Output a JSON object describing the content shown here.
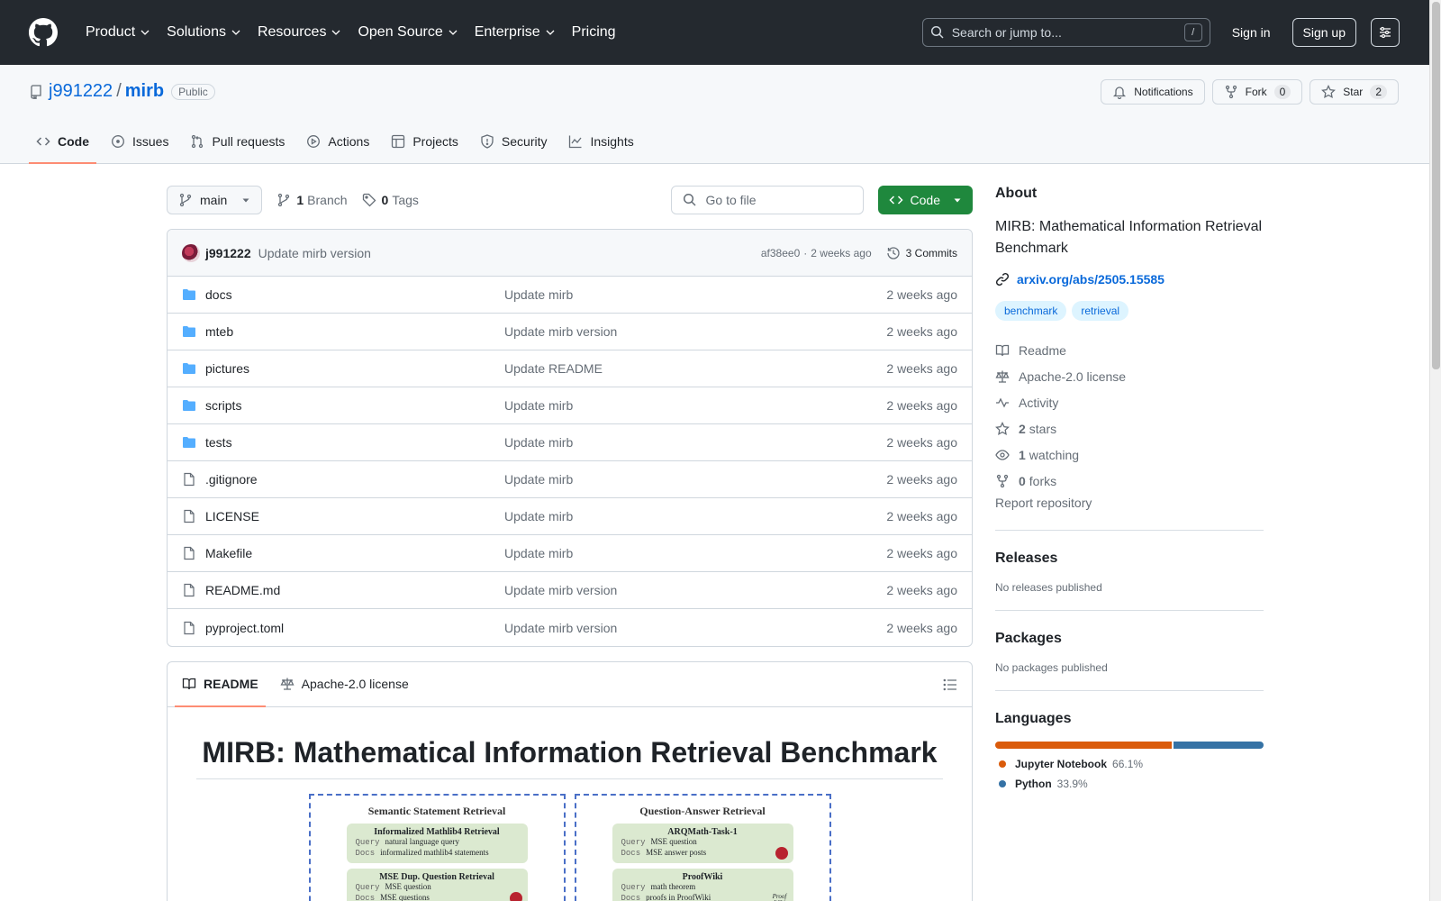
{
  "header": {
    "nav": [
      "Product",
      "Solutions",
      "Resources",
      "Open Source",
      "Enterprise",
      "Pricing"
    ],
    "search_placeholder": "Search or jump to...",
    "search_shortcut": "/",
    "signin": "Sign in",
    "signup": "Sign up"
  },
  "repo": {
    "owner": "j991222",
    "sep": "/",
    "name": "mirb",
    "visibility": "Public",
    "notifications": "Notifications",
    "fork_label": "Fork",
    "fork_count": "0",
    "star_label": "Star",
    "star_count": "2",
    "tabs": [
      "Code",
      "Issues",
      "Pull requests",
      "Actions",
      "Projects",
      "Security",
      "Insights"
    ]
  },
  "toolbar": {
    "branch": "main",
    "branch_count": "1",
    "branch_label": "Branch",
    "tag_count": "0",
    "tag_label": "Tags",
    "goto_placeholder": "Go to file",
    "code_button": "Code"
  },
  "commit": {
    "user": "j991222",
    "message": "Update mirb version",
    "hash": "af38ee0",
    "dot": "·",
    "time": "2 weeks ago",
    "commits": "3 Commits"
  },
  "files": [
    {
      "name": "docs",
      "type": "dir",
      "message": "Update mirb",
      "time": "2 weeks ago"
    },
    {
      "name": "mteb",
      "type": "dir",
      "message": "Update mirb version",
      "time": "2 weeks ago"
    },
    {
      "name": "pictures",
      "type": "dir",
      "message": "Update README",
      "time": "2 weeks ago"
    },
    {
      "name": "scripts",
      "type": "dir",
      "message": "Update mirb",
      "time": "2 weeks ago"
    },
    {
      "name": "tests",
      "type": "dir",
      "message": "Update mirb",
      "time": "2 weeks ago"
    },
    {
      "name": ".gitignore",
      "type": "file",
      "message": "Update mirb",
      "time": "2 weeks ago"
    },
    {
      "name": "LICENSE",
      "type": "file",
      "message": "Update mirb",
      "time": "2 weeks ago"
    },
    {
      "name": "Makefile",
      "type": "file",
      "message": "Update mirb",
      "time": "2 weeks ago"
    },
    {
      "name": "README.md",
      "type": "file",
      "message": "Update mirb version",
      "time": "2 weeks ago"
    },
    {
      "name": "pyproject.toml",
      "type": "file",
      "message": "Update mirb version",
      "time": "2 weeks ago"
    }
  ],
  "readme": {
    "tab_readme": "README",
    "tab_license": "Apache-2.0 license",
    "title": "MIRB: Mathematical Information Retrieval Benchmark",
    "figure": {
      "left_title": "Semantic Statement Retrieval",
      "left_cards": [
        {
          "title": "Informalized Mathlib4 Retrieval",
          "query": "natural language query",
          "docs": "informalized mathlib4 statements"
        },
        {
          "title": "MSE Dup. Question Retrieval",
          "query": "MSE question",
          "docs": "MSE questions"
        }
      ],
      "right_title": "Question-Answer Retrieval",
      "right_cards": [
        {
          "title": "ARQMath-Task-1",
          "query": "MSE question",
          "docs": "MSE answer posts"
        },
        {
          "title": "ProofWiki",
          "query": "math theorem",
          "docs": "proofs in ProofWiki"
        }
      ],
      "query_label": "Query",
      "docs_label": "Docs",
      "proofwiki_mark": "Proof Wiki"
    }
  },
  "about": {
    "heading": "About",
    "description": "MIRB: Mathematical Information Retrieval Benchmark",
    "link": "arxiv.org/abs/2505.15585",
    "topics": [
      "benchmark",
      "retrieval"
    ],
    "readme": "Readme",
    "license": "Apache-2.0 license",
    "activity": "Activity",
    "stars_count": "2",
    "stars_label": "stars",
    "watching_count": "1",
    "watching_label": "watching",
    "forks_count": "0",
    "forks_label": "forks",
    "report": "Report repository"
  },
  "releases": {
    "heading": "Releases",
    "text": "No releases published"
  },
  "packages": {
    "heading": "Packages",
    "text": "No packages published"
  },
  "languages": {
    "heading": "Languages",
    "items": [
      {
        "name": "Jupyter Notebook",
        "percent": "66.1%",
        "value": 66.1,
        "color": "#DA5B0B"
      },
      {
        "name": "Python",
        "percent": "33.9%",
        "value": 33.9,
        "color": "#3572A5"
      }
    ]
  }
}
